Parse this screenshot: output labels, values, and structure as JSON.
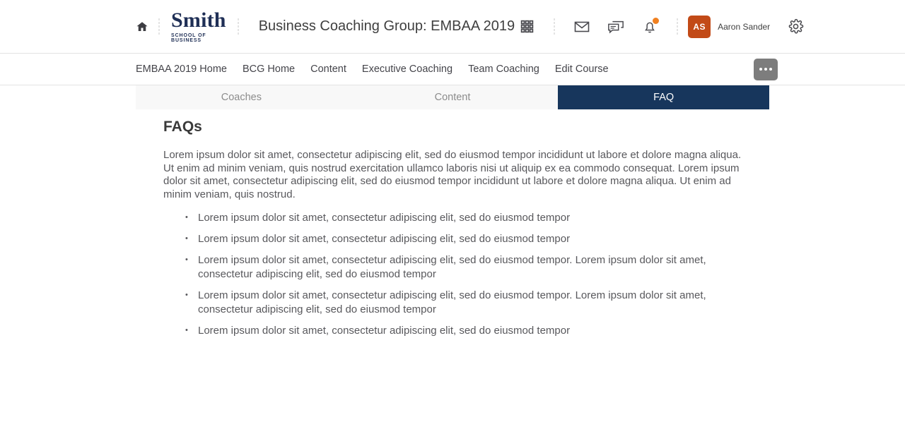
{
  "header": {
    "home_icon": "home-icon",
    "brand": {
      "main": "Smith",
      "sub": "SCHOOL OF BUSINESS"
    },
    "course_title": "Business Coaching Group: EMBAA 2019",
    "icons": [
      {
        "name": "apps-grid-icon",
        "label": "Apps"
      },
      {
        "name": "mail-icon",
        "label": "Mail"
      },
      {
        "name": "chat-icon",
        "label": "Chat"
      },
      {
        "name": "bell-icon",
        "label": "Notifications",
        "has_badge": true
      }
    ],
    "user": {
      "initials": "AS",
      "name": "Aaron Sander",
      "avatar_color": "#c24a17"
    },
    "settings_icon": "gear-icon",
    "badge_color": "#f08020"
  },
  "subnav": {
    "links": [
      "EMBAA 2019 Home",
      "BCG Home",
      "Content",
      "Executive Coaching",
      "Team Coaching",
      "Edit Course"
    ],
    "more_button": {
      "name": "more-options-button",
      "label": "..."
    }
  },
  "tabs": [
    {
      "label": "Coaches",
      "active": false
    },
    {
      "label": "Content",
      "active": false
    },
    {
      "label": "FAQ",
      "active": true
    }
  ],
  "tab_colors": {
    "active_bg": "#17365c",
    "active_text": "#ffffff",
    "inactive_bg": "#f8f8f8",
    "inactive_text": "#8c8c8c"
  },
  "main": {
    "title": "FAQs",
    "paragraph": "Lorem ipsum dolor sit amet, consectetur adipiscing elit, sed do eiusmod tempor incididunt ut labore et dolore magna aliqua. Ut enim ad minim veniam, quis nostrud exercitation ullamco laboris nisi ut aliquip ex ea commodo consequat. Lorem ipsum dolor sit amet, consectetur adipiscing elit, sed do eiusmod tempor incididunt ut labore et dolore magna aliqua. Ut enim ad minim veniam, quis nostrud.",
    "bullets": [
      "Lorem ipsum dolor sit amet, consectetur adipiscing elit, sed do eiusmod tempor",
      "Lorem ipsum dolor sit amet, consectetur adipiscing elit, sed do eiusmod tempor",
      "Lorem ipsum dolor sit amet, consectetur adipiscing elit, sed do eiusmod tempor. Lorem ipsum dolor sit amet, consectetur adipiscing elit, sed do eiusmod tempor",
      "Lorem ipsum dolor sit amet, consectetur adipiscing elit, sed do eiusmod tempor. Lorem ipsum dolor sit amet, consectetur adipiscing elit, sed do eiusmod tempor",
      "Lorem ipsum dolor sit amet, consectetur adipiscing elit, sed do eiusmod tempor"
    ]
  }
}
